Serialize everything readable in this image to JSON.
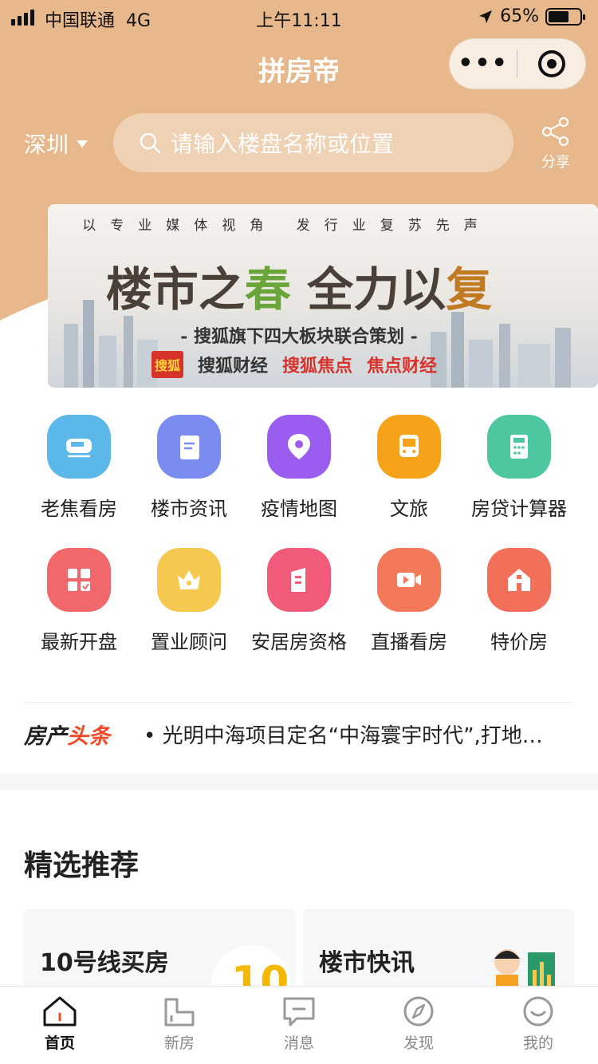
{
  "status": {
    "carrier": "中国联通",
    "network": "4G",
    "time": "上午11:11",
    "battery": "65%",
    "battery_level": 0.65
  },
  "nav": {
    "title": "拼房帝"
  },
  "location": {
    "city": "深圳"
  },
  "search": {
    "placeholder": "请输入楼盘名称或位置"
  },
  "share": {
    "label": "分享"
  },
  "banner": {
    "top_line": "以专业媒体视角  发行业复苏先声",
    "headline_a": "楼市之",
    "headline_b": "春",
    "headline_c": " 全力以",
    "headline_d": "复",
    "subtitle": "- 搜狐旗下四大板块联合策划 -",
    "logo_1": "搜狐",
    "logo_2": "搜狐财经",
    "logo_3": "搜狐焦点",
    "logo_4": "焦点财经"
  },
  "grid": {
    "items": [
      {
        "label": "老焦看房",
        "icon": "train-icon",
        "color": "#5bb8e8"
      },
      {
        "label": "楼市资讯",
        "icon": "document-icon",
        "color": "#7b8cf0"
      },
      {
        "label": "疫情地图",
        "icon": "map-pin-icon",
        "color": "#9b5cf0"
      },
      {
        "label": "文旅",
        "icon": "bus-icon",
        "color": "#f7a21b"
      },
      {
        "label": "房贷计算器",
        "icon": "calculator-icon",
        "color": "#4cc7a0"
      },
      {
        "label": "最新开盘",
        "icon": "grid-check-icon",
        "color": "#f0686a"
      },
      {
        "label": "置业顾问",
        "icon": "crown-icon",
        "color": "#f5c850"
      },
      {
        "label": "安居房资格",
        "icon": "building-icon",
        "color": "#f25a7a"
      },
      {
        "label": "直播看房",
        "icon": "video-icon",
        "color": "#f27a5a"
      },
      {
        "label": "特价房",
        "icon": "house-icon",
        "color": "#f2705a"
      }
    ]
  },
  "news": {
    "tag_a": "房产",
    "tag_b": "头条",
    "text": "• 光明中海项目定名“中海寰宇时代”,打地…"
  },
  "recommend": {
    "title": "精选推荐",
    "cards": [
      "10号线买房",
      "楼市快讯"
    ]
  },
  "tabbar": {
    "items": [
      "首页",
      "新房",
      "消息",
      "发现",
      "我的"
    ]
  }
}
